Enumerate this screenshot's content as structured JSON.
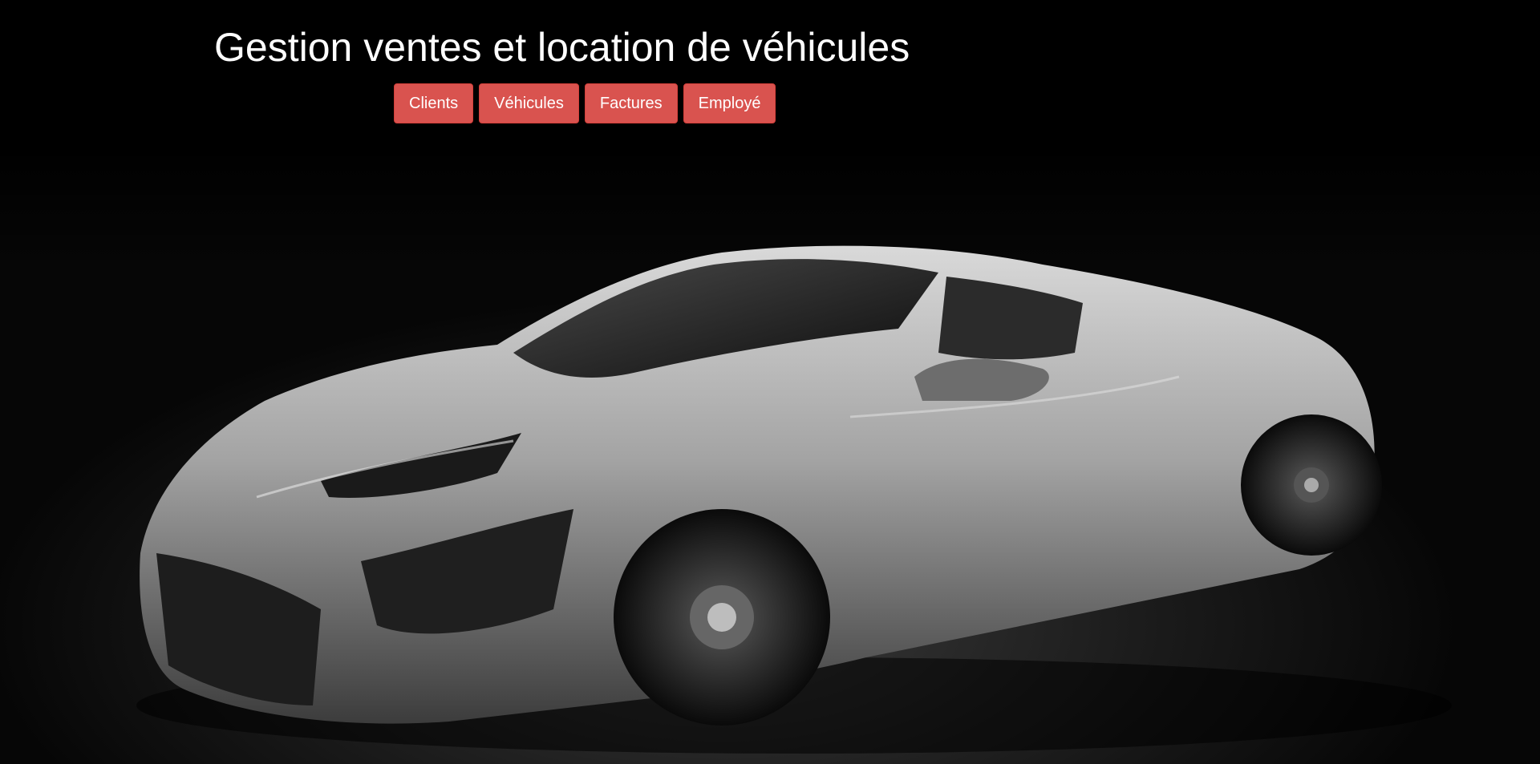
{
  "header": {
    "title": "Gestion ventes et location de véhicules"
  },
  "nav": {
    "items": [
      {
        "label": "Clients"
      },
      {
        "label": "Véhicules"
      },
      {
        "label": "Factures"
      },
      {
        "label": "Employé"
      }
    ]
  },
  "colors": {
    "background": "#000000",
    "button": "#d9534f",
    "title_text": "#ffffff",
    "car_body": "#9a9a9a"
  },
  "hero": {
    "image_subject": "silver sports car"
  }
}
